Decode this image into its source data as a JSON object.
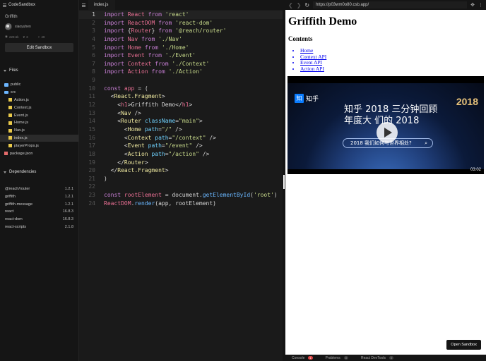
{
  "app": {
    "name": "CodeSandbox"
  },
  "project": {
    "name": "Griffith",
    "author": "xiaoyuhen",
    "views": "229.6k",
    "likes": "3",
    "forks": "49",
    "edit_label": "Edit Sandbox"
  },
  "files": {
    "title": "Files",
    "items": [
      {
        "name": "public",
        "type": "folder",
        "level": 0
      },
      {
        "name": "src",
        "type": "folder",
        "level": 0
      },
      {
        "name": "Action.js",
        "type": "js",
        "level": 1
      },
      {
        "name": "Context.js",
        "type": "js",
        "level": 1
      },
      {
        "name": "Event.js",
        "type": "js",
        "level": 1
      },
      {
        "name": "Home.js",
        "type": "js",
        "level": 1
      },
      {
        "name": "Nav.js",
        "type": "js",
        "level": 1
      },
      {
        "name": "index.js",
        "type": "js",
        "level": 1,
        "active": true
      },
      {
        "name": "playerProps.js",
        "type": "js",
        "level": 1
      },
      {
        "name": "package.json",
        "type": "json",
        "level": 0
      }
    ]
  },
  "dependencies": {
    "title": "Dependencies",
    "items": [
      {
        "name": "@reach/router",
        "version": "1.2.1"
      },
      {
        "name": "griffith",
        "version": "1.2.1"
      },
      {
        "name": "griffith-message",
        "version": "1.2.1"
      },
      {
        "name": "react",
        "version": "16.8.3"
      },
      {
        "name": "react-dom",
        "version": "16.8.3"
      },
      {
        "name": "react-scripts",
        "version": "2.1.8"
      }
    ]
  },
  "editor": {
    "tab": "index.js",
    "current_line": 1,
    "lines": [
      [
        [
          "k",
          "import"
        ],
        [
          "p",
          " "
        ],
        [
          "c",
          "React"
        ],
        [
          "p",
          " "
        ],
        [
          "k",
          "from"
        ],
        [
          "p",
          " "
        ],
        [
          "s",
          "'react'"
        ]
      ],
      [
        [
          "k",
          "import"
        ],
        [
          "p",
          " "
        ],
        [
          "c",
          "ReactDOM"
        ],
        [
          "p",
          " "
        ],
        [
          "k",
          "from"
        ],
        [
          "p",
          " "
        ],
        [
          "s",
          "'react-dom'"
        ]
      ],
      [
        [
          "k",
          "import"
        ],
        [
          "p",
          " {"
        ],
        [
          "c",
          "Router"
        ],
        [
          "p",
          "} "
        ],
        [
          "k",
          "from"
        ],
        [
          "p",
          " "
        ],
        [
          "s",
          "'@reach/router'"
        ]
      ],
      [
        [
          "k",
          "import"
        ],
        [
          "p",
          " "
        ],
        [
          "c",
          "Nav"
        ],
        [
          "p",
          " "
        ],
        [
          "k",
          "from"
        ],
        [
          "p",
          " "
        ],
        [
          "s",
          "'./Nav'"
        ]
      ],
      [
        [
          "k",
          "import"
        ],
        [
          "p",
          " "
        ],
        [
          "c",
          "Home"
        ],
        [
          "p",
          " "
        ],
        [
          "k",
          "from"
        ],
        [
          "p",
          " "
        ],
        [
          "s",
          "'./Home'"
        ]
      ],
      [
        [
          "k",
          "import"
        ],
        [
          "p",
          " "
        ],
        [
          "c",
          "Event"
        ],
        [
          "p",
          " "
        ],
        [
          "k",
          "from"
        ],
        [
          "p",
          " "
        ],
        [
          "s",
          "'./Event'"
        ]
      ],
      [
        [
          "k",
          "import"
        ],
        [
          "p",
          " "
        ],
        [
          "c",
          "Context"
        ],
        [
          "p",
          " "
        ],
        [
          "k",
          "from"
        ],
        [
          "p",
          " "
        ],
        [
          "s",
          "'./Context'"
        ]
      ],
      [
        [
          "k",
          "import"
        ],
        [
          "p",
          " "
        ],
        [
          "c",
          "Action"
        ],
        [
          "p",
          " "
        ],
        [
          "k",
          "from"
        ],
        [
          "p",
          " "
        ],
        [
          "s",
          "'./Action'"
        ]
      ],
      [],
      [
        [
          "k",
          "const"
        ],
        [
          "p",
          " "
        ],
        [
          "c",
          "app"
        ],
        [
          "p",
          " = ("
        ]
      ],
      [
        [
          "p",
          "  <"
        ],
        [
          "t",
          "React.Fragment"
        ],
        [
          "p",
          ">"
        ]
      ],
      [
        [
          "p",
          "    <"
        ],
        [
          "c",
          "h1"
        ],
        [
          "p",
          ">Griffith Demo</"
        ],
        [
          "c",
          "h1"
        ],
        [
          "p",
          ">"
        ]
      ],
      [
        [
          "p",
          "    <"
        ],
        [
          "t",
          "Nav"
        ],
        [
          "p",
          " />"
        ]
      ],
      [
        [
          "p",
          "    <"
        ],
        [
          "t",
          "Router"
        ],
        [
          "p",
          " "
        ],
        [
          "a",
          "className"
        ],
        [
          "p",
          "="
        ],
        [
          "s",
          "\"main\""
        ],
        [
          "p",
          ">"
        ]
      ],
      [
        [
          "p",
          "      <"
        ],
        [
          "t",
          "Home"
        ],
        [
          "p",
          " "
        ],
        [
          "a",
          "path"
        ],
        [
          "p",
          "="
        ],
        [
          "s",
          "\"/\""
        ],
        [
          "p",
          " />"
        ]
      ],
      [
        [
          "p",
          "      <"
        ],
        [
          "t",
          "Context"
        ],
        [
          "p",
          " "
        ],
        [
          "a",
          "path"
        ],
        [
          "p",
          "="
        ],
        [
          "s",
          "\"/context\""
        ],
        [
          "p",
          " />"
        ]
      ],
      [
        [
          "p",
          "      <"
        ],
        [
          "t",
          "Event"
        ],
        [
          "p",
          " "
        ],
        [
          "a",
          "path"
        ],
        [
          "p",
          "="
        ],
        [
          "s",
          "\"/event\""
        ],
        [
          "p",
          " />"
        ]
      ],
      [
        [
          "p",
          "      <"
        ],
        [
          "t",
          "Action"
        ],
        [
          "p",
          " "
        ],
        [
          "a",
          "path"
        ],
        [
          "p",
          "="
        ],
        [
          "s",
          "\"/action\""
        ],
        [
          "p",
          " />"
        ]
      ],
      [
        [
          "p",
          "    </"
        ],
        [
          "t",
          "Router"
        ],
        [
          "p",
          ">"
        ]
      ],
      [
        [
          "p",
          "  </"
        ],
        [
          "t",
          "React.Fragment"
        ],
        [
          "p",
          ">"
        ]
      ],
      [
        [
          "p",
          ")"
        ]
      ],
      [],
      [
        [
          "k",
          "const"
        ],
        [
          "p",
          " "
        ],
        [
          "c",
          "rootElement"
        ],
        [
          "p",
          " = document."
        ],
        [
          "f",
          "getElementById"
        ],
        [
          "p",
          "("
        ],
        [
          "s",
          "'root'"
        ],
        [
          "p",
          ")"
        ]
      ],
      [
        [
          "c",
          "ReactDOM"
        ],
        [
          "p",
          "."
        ],
        [
          "f",
          "render"
        ],
        [
          "p",
          "(app, rootElement)"
        ]
      ]
    ]
  },
  "browser": {
    "url": "https://p03wm0o80.csb.app/",
    "back": "❮",
    "forward": "❯",
    "reload": "↻",
    "extra_icon": "✥",
    "menu_icon": "⋮"
  },
  "preview_page": {
    "title": "Griffith Demo",
    "contents_heading": "Contents",
    "links": [
      "Home",
      "Context API",
      "Event API",
      "Action API"
    ],
    "video": {
      "logo": "知乎",
      "title_line1": "知乎  2018 三分钟回顾",
      "title_line2": "年度大          们的 2018",
      "search_text": "2018 我们如何与世界相处?",
      "badge": "2018",
      "duration": "03:02"
    },
    "open_sandbox_label": "Open Sandbox"
  },
  "bottom_tabs": [
    {
      "label": "Console",
      "count": "1",
      "alert": true
    },
    {
      "label": "Problems",
      "count": "0",
      "alert": false
    },
    {
      "label": "React DevTools",
      "count": "0",
      "alert": false
    }
  ]
}
